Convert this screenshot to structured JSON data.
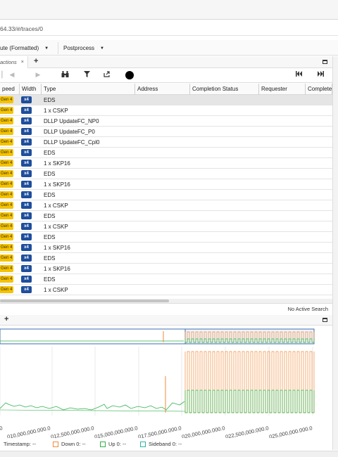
{
  "browser": {
    "url": "64.33/#/traces/0"
  },
  "toolbar": {
    "view_select": "ute (Formatted)",
    "postprocess_select": "Postprocess"
  },
  "transactions_tab": {
    "label": "actions",
    "close": "×",
    "add": "+"
  },
  "columns": [
    "peed",
    "Width",
    "Type",
    "Address",
    "Completion Status",
    "Requester",
    "Complete"
  ],
  "rows": [
    {
      "speed": "Gen 4",
      "width": "x4",
      "type": "EDS"
    },
    {
      "speed": "Gen 4",
      "width": "x4",
      "type": "1 x CSKP"
    },
    {
      "speed": "Gen 4",
      "width": "x4",
      "type": "DLLP UpdateFC_NP0"
    },
    {
      "speed": "Gen 4",
      "width": "x4",
      "type": "DLLP UpdateFC_P0"
    },
    {
      "speed": "Gen 4",
      "width": "x4",
      "type": "DLLP UpdateFC_Cpl0"
    },
    {
      "speed": "Gen 4",
      "width": "x4",
      "type": "EDS"
    },
    {
      "speed": "Gen 4",
      "width": "x4",
      "type": "1 x SKP16"
    },
    {
      "speed": "Gen 4",
      "width": "x4",
      "type": "EDS"
    },
    {
      "speed": "Gen 4",
      "width": "x4",
      "type": "1 x SKP16"
    },
    {
      "speed": "Gen 4",
      "width": "x4",
      "type": "EDS"
    },
    {
      "speed": "Gen 4",
      "width": "x4",
      "type": "1 x CSKP"
    },
    {
      "speed": "Gen 4",
      "width": "x4",
      "type": "EDS"
    },
    {
      "speed": "Gen 4",
      "width": "x4",
      "type": "1 x CSKP"
    },
    {
      "speed": "Gen 4",
      "width": "x4",
      "type": "EDS"
    },
    {
      "speed": "Gen 4",
      "width": "x4",
      "type": "1 x SKP16"
    },
    {
      "speed": "Gen 4",
      "width": "x4",
      "type": "EDS"
    },
    {
      "speed": "Gen 4",
      "width": "x4",
      "type": "1 x SKP16"
    },
    {
      "speed": "Gen 4",
      "width": "x4",
      "type": "EDS"
    },
    {
      "speed": "Gen 4",
      "width": "x4",
      "type": "1 x CSKP"
    }
  ],
  "search_status": "No Active Search",
  "plot_tab": {
    "add": "+"
  },
  "axis_ticks": [
    ".000",
    "010,000,000.000.0",
    "012,500,000.000.0",
    "015,000,000.000.0",
    "017,500,000.000.0",
    "020,000,000.000.0",
    "022,500,000.000.0",
    "025,000,000.000.0"
  ],
  "legend": {
    "timestamp_label": "Timestamp:",
    "timestamp_value": "--",
    "down_label": "Down 0:",
    "down_value": "--",
    "up_label": "Up 0:",
    "up_value": "--",
    "sideband_label": "Sideband 0:",
    "sideband_value": "--"
  },
  "colors": {
    "gen_badge": "#f4c300",
    "width_badge": "#1e4e9c",
    "down": "#f08a3a",
    "up": "#2fb24a",
    "sideband": "#2cb5a8"
  },
  "icons": [
    "prev-icon",
    "next-icon",
    "binoculars-icon",
    "filter-icon",
    "export-icon",
    "record-icon",
    "skip-first-icon",
    "skip-last-icon"
  ]
}
